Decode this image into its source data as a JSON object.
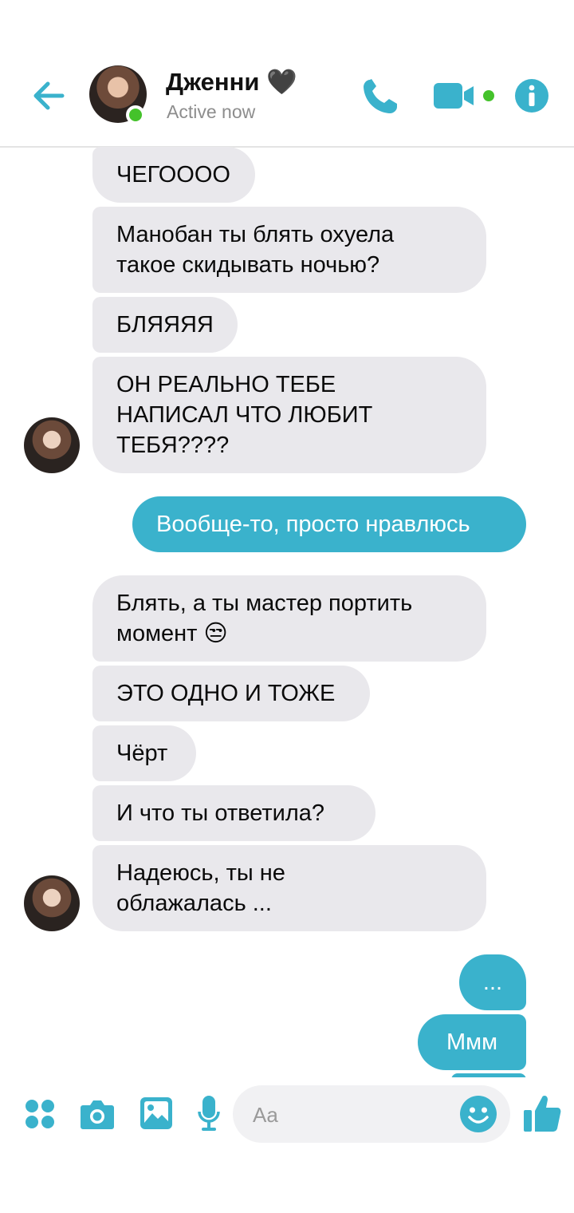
{
  "header": {
    "contact_name": "Дженни 🖤",
    "status": "Active now"
  },
  "messages": [
    {
      "side": "in",
      "text": "ЧЕГОООО"
    },
    {
      "side": "in",
      "text": "Манобан ты блять охуела\nтакое скидывать ночью?"
    },
    {
      "side": "in",
      "text": "БЛЯЯЯЯ"
    },
    {
      "side": "in",
      "text": "ОН РЕАЛЬНО ТЕБЕ\nНАПИСАЛ ЧТО ЛЮБИТ\nТЕБЯ????"
    },
    {
      "side": "out",
      "text": "Вообще-то, просто нравлюсь"
    },
    {
      "side": "in",
      "text": "Блять, а ты мастер портить\nмомент 😒"
    },
    {
      "side": "in",
      "text": "ЭТО ОДНО И ТОЖЕ"
    },
    {
      "side": "in",
      "text": "Чёрт"
    },
    {
      "side": "in",
      "text": "И что ты ответила?"
    },
    {
      "side": "in",
      "text": "Надеюсь, ты не\nоблажалась ..."
    },
    {
      "side": "out",
      "text": "..."
    },
    {
      "side": "out",
      "text": "Ммм"
    }
  ],
  "composer": {
    "placeholder": "Aa"
  },
  "colors": {
    "accent": "#3ab2cc",
    "incoming_bubble": "#e9e8ec",
    "online": "#44c22b"
  },
  "icons": [
    "back-arrow-icon",
    "phone-icon",
    "video-camera-icon",
    "info-icon",
    "apps-grid-icon",
    "camera-icon",
    "gallery-icon",
    "microphone-icon",
    "emoji-icon",
    "thumbs-up-icon"
  ]
}
